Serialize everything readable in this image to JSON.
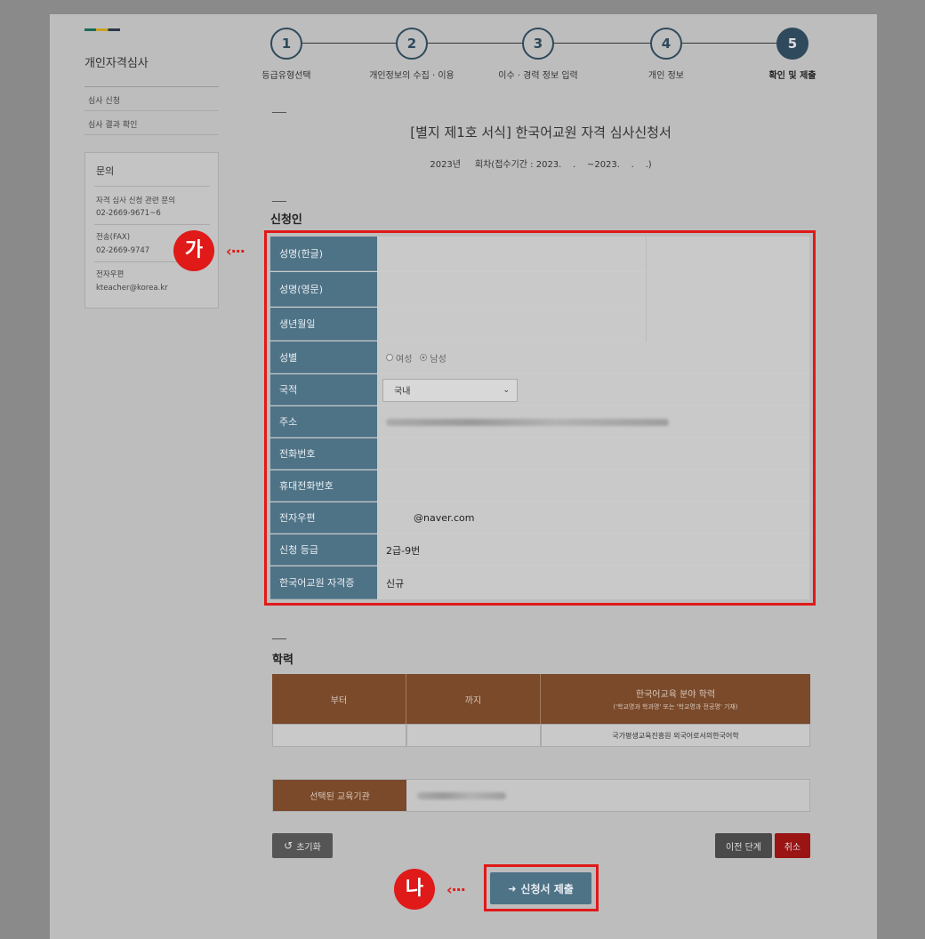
{
  "sidebar": {
    "title": "개인자격심사",
    "links": [
      "심사 신청",
      "심사 결과 확인"
    ],
    "inquiry": {
      "title": "문의",
      "items": [
        {
          "label": "자격 심사 신청 관련 문의",
          "value": "02-2669-9671~6"
        },
        {
          "label": "전송(FAX)",
          "value": "02-2669-9747"
        },
        {
          "label": "전자우편",
          "value": "kteacher@korea.kr"
        }
      ]
    }
  },
  "steps": [
    {
      "num": "1",
      "label": "등급유형선택"
    },
    {
      "num": "2",
      "label": "개인정보의 수집 · 이용"
    },
    {
      "num": "3",
      "label": "이수 · 경력 정보 입력"
    },
    {
      "num": "4",
      "label": "개인 정보"
    },
    {
      "num": "5",
      "label": "확인 및 제출"
    }
  ],
  "form": {
    "title": "[별지 제1호 서식] 한국어교원 자격 심사신청서",
    "subtitle": "2023년     회차(접수기간 : 2023.    .    ~2023.    .    .)"
  },
  "applicant": {
    "section_title": "신청인",
    "rows": [
      {
        "label": "성명(한글)",
        "value": ""
      },
      {
        "label": "성명(영문)",
        "value": ""
      },
      {
        "label": "생년월일",
        "value": ""
      },
      {
        "label": "성별",
        "value": ""
      },
      {
        "label": "국적",
        "value": ""
      },
      {
        "label": "주소",
        "value": ""
      },
      {
        "label": "전화번호",
        "value": ""
      },
      {
        "label": "휴대전화번호",
        "value": ""
      },
      {
        "label": "전자우편",
        "value": "@naver.com"
      },
      {
        "label": "신청 등급",
        "value": "2급-9번"
      },
      {
        "label": "한국어교원 자격증",
        "value": "신규"
      }
    ],
    "gender_options": [
      "여성",
      "남성"
    ],
    "gender_selected": "남성",
    "nationality_selected": "국내"
  },
  "education": {
    "section_title": "학력",
    "headers": [
      "부터",
      "까지",
      "한국어교육 분야 학력"
    ],
    "header_note": "('학교명과 학과명' 또는 '학교명과 전공명' 기재)",
    "row": [
      "",
      "",
      "국가평생교육진흥원 외국어로서의한국어학"
    ]
  },
  "institution": {
    "label": "선택된 교육기관"
  },
  "buttons": {
    "reset": "초기화",
    "prev": "이전 단계",
    "cancel": "취소",
    "submit": "신청서 제출"
  },
  "callouts": {
    "a": "가",
    "b": "나"
  },
  "colors": {
    "header_blue": "#4f7386",
    "header_brown": "#7a4a2b",
    "highlight_red": "#e01919"
  }
}
